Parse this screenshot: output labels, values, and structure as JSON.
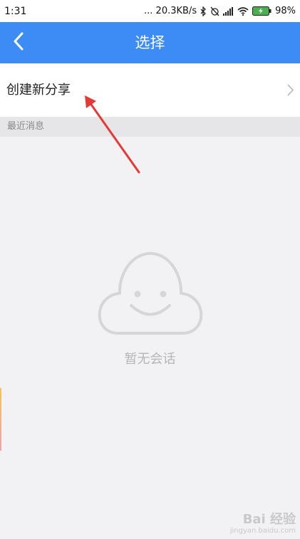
{
  "status_bar": {
    "time": "1:31",
    "network_speed": "... 20.3KB/s",
    "battery": "98%",
    "icons": [
      "bluetooth-icon",
      "alarm-off-icon",
      "signal-icon",
      "wifi-icon",
      "battery-icon"
    ]
  },
  "nav": {
    "title": "选择",
    "back_icon": "back-chevron-icon",
    "color": "#3d8bf5"
  },
  "share": {
    "label": "创建新分享",
    "chevron_icon": "chevron-right-icon"
  },
  "recent": {
    "header": "最近消息"
  },
  "empty_state": {
    "icon": "cloud-smile-icon",
    "text": "暂无会话"
  },
  "annotation": {
    "type": "arrow",
    "color": "#e53935"
  },
  "watermark": {
    "brand": "Bai 经验",
    "url": "jingyan.baidu.com"
  }
}
